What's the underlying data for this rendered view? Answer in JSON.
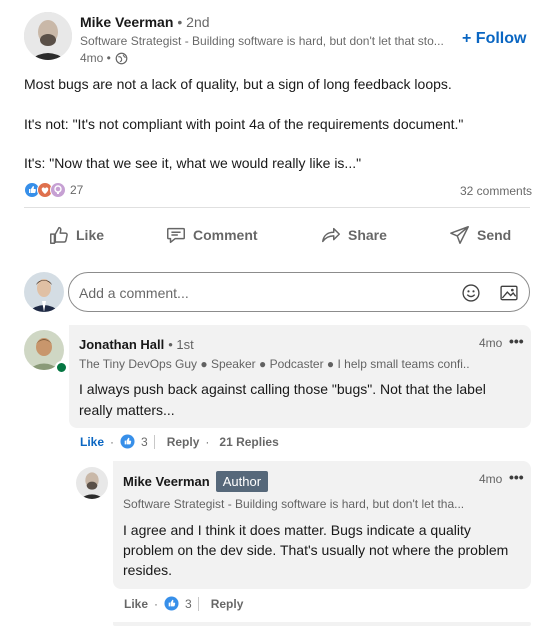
{
  "post": {
    "author": {
      "name": "Mike Veerman",
      "degree": "• 2nd",
      "tagline": "Software Strategist - Building software is hard, but don't let that sto...",
      "time": "4mo •",
      "globe_icon": "globe-icon"
    },
    "follow_label": "+ Follow",
    "text_lines": [
      "Most bugs are not a lack of quality, but a sign of long feedback loops.",
      "It's not: \"It's not compliant with point 4a of the requirements document.\"",
      "It's: \"Now that we see it, what we would really like is...\""
    ],
    "reactions_count": "27",
    "comments_count": "32 comments"
  },
  "actions": {
    "like": "Like",
    "comment": "Comment",
    "share": "Share",
    "send": "Send"
  },
  "composer": {
    "placeholder": "Add a comment..."
  },
  "comments": [
    {
      "name": "Jonathan Hall",
      "degree": "• 1st",
      "tagline": "The Tiny DevOps Guy ● Speaker ● Podcaster ● I help small teams confi...",
      "time": "4mo",
      "text_lines": [
        "I always push back against calling those \"bugs\". Not that the label",
        "really matters..."
      ],
      "like_label": "Like",
      "reaction_count": "3",
      "reply_label": "Reply",
      "replies_label": "21 Replies"
    }
  ],
  "reply": {
    "name": "Mike Veerman",
    "author_badge": "Author",
    "tagline": "Software Strategist - Building software is hard, but don't let tha...",
    "time": "4mo",
    "text_lines": [
      "I agree and I think it does matter. Bugs indicate a quality",
      "problem on the dev side. That's usually not where the problem",
      "resides."
    ],
    "like_label": "Like",
    "reaction_count": "3",
    "reply_label": "Reply"
  },
  "colors": {
    "accent": "#0a66c2",
    "bubble": "#f2f2f2",
    "online": "#057642",
    "badge_bg": "#56687a"
  }
}
